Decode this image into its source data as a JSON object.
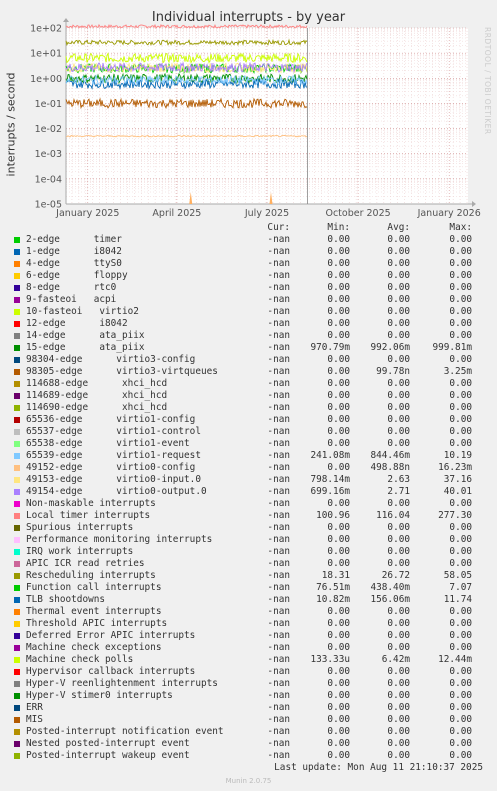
{
  "chart_data": {
    "type": "line",
    "title": "Individual interrupts - by year",
    "ylabel": "interrupts / second",
    "yscale": "log",
    "ylim": [
      1e-05,
      100
    ],
    "yticks": [
      "1e+02",
      "1e+01",
      "1e+00",
      "1e-01",
      "1e-02",
      "1e-03",
      "1e-04",
      "1e-05"
    ],
    "xlim": [
      "2024-12-10",
      "2026-01-20"
    ],
    "xticks": [
      {
        "label": "January 2025",
        "date": "2025-01-01"
      },
      {
        "label": "April 2025",
        "date": "2025-04-01"
      },
      {
        "label": "July 2025",
        "date": "2025-07-01"
      },
      {
        "label": "October 2025",
        "date": "2025-10-01"
      },
      {
        "label": "January 2026",
        "date": "2026-01-01"
      }
    ],
    "now_marker": "2025-08-11",
    "grid": true,
    "series": [
      {
        "name": "Local timer interrupts",
        "approx": 116.0
      },
      {
        "name": "Rescheduling interrupts",
        "approx": 26.7
      },
      {
        "name": "Machine check polls",
        "approx": 6.4
      },
      {
        "name": "Function call interrupts",
        "approx": 2.5
      },
      {
        "name": "49153-edge virtio0-input.0",
        "approx": 2.6
      },
      {
        "name": "49154-edge virtio0-output.0",
        "approx": 2.7
      },
      {
        "name": "15-edge ata_piix",
        "approx": 0.99
      },
      {
        "name": "TLB shootdowns",
        "approx": 0.6
      },
      {
        "name": "65539-edge virtio1-request",
        "approx": 0.84
      },
      {
        "name": "98305-edge virtio3-virtqueues",
        "approx": 0.1
      },
      {
        "name": "49152-edge virtio0-config",
        "approx": 0.005
      },
      {
        "name": "spike",
        "points": [
          [
            "2025-04-15",
            3e-05
          ],
          [
            "2025-07-05",
            3e-05
          ]
        ]
      }
    ]
  },
  "legend": {
    "headers": {
      "cur": "Cur:",
      "min": "Min:",
      "avg": "Avg:",
      "max": "Max:"
    },
    "rows": [
      {
        "label": "2-edge      timer",
        "color": "#00cc00",
        "cur": "-nan",
        "min": "0.00",
        "avg": "0.00",
        "max": "0.00"
      },
      {
        "label": "1-edge      i8042",
        "color": "#0066b3",
        "cur": "-nan",
        "min": "0.00",
        "avg": "0.00",
        "max": "0.00"
      },
      {
        "label": "4-edge      ttyS0",
        "color": "#ff8000",
        "cur": "-nan",
        "min": "0.00",
        "avg": "0.00",
        "max": "0.00"
      },
      {
        "label": "6-edge      floppy",
        "color": "#ffcc00",
        "cur": "-nan",
        "min": "0.00",
        "avg": "0.00",
        "max": "0.00"
      },
      {
        "label": "8-edge      rtc0",
        "color": "#330099",
        "cur": "-nan",
        "min": "0.00",
        "avg": "0.00",
        "max": "0.00"
      },
      {
        "label": "9-fasteoi   acpi",
        "color": "#990099",
        "cur": "-nan",
        "min": "0.00",
        "avg": "0.00",
        "max": "0.00"
      },
      {
        "label": "10-fasteoi   virtio2",
        "color": "#ccff00",
        "cur": "-nan",
        "min": "0.00",
        "avg": "0.00",
        "max": "0.00"
      },
      {
        "label": "12-edge      i8042",
        "color": "#ff0000",
        "cur": "-nan",
        "min": "0.00",
        "avg": "0.00",
        "max": "0.00"
      },
      {
        "label": "14-edge      ata_piix",
        "color": "#808080",
        "cur": "-nan",
        "min": "0.00",
        "avg": "0.00",
        "max": "0.00"
      },
      {
        "label": "15-edge      ata_piix",
        "color": "#008f00",
        "cur": "-nan",
        "min": "970.79m",
        "avg": "992.06m",
        "max": "999.81m"
      },
      {
        "label": "98304-edge      virtio3-config",
        "color": "#00487d",
        "cur": "-nan",
        "min": "0.00",
        "avg": "0.00",
        "max": "0.00"
      },
      {
        "label": "98305-edge      virtio3-virtqueues",
        "color": "#b35a00",
        "cur": "-nan",
        "min": "0.00",
        "avg": "99.78n",
        "max": "3.25m"
      },
      {
        "label": "114688-edge      xhci_hcd",
        "color": "#b38f00",
        "cur": "-nan",
        "min": "0.00",
        "avg": "0.00",
        "max": "0.00"
      },
      {
        "label": "114689-edge      xhci_hcd",
        "color": "#6b006b",
        "cur": "-nan",
        "min": "0.00",
        "avg": "0.00",
        "max": "0.00"
      },
      {
        "label": "114690-edge      xhci_hcd",
        "color": "#8fb300",
        "cur": "-nan",
        "min": "0.00",
        "avg": "0.00",
        "max": "0.00"
      },
      {
        "label": "65536-edge      virtio1-config",
        "color": "#b30000",
        "cur": "-nan",
        "min": "0.00",
        "avg": "0.00",
        "max": "0.00"
      },
      {
        "label": "65537-edge      virtio1-control",
        "color": "#bebebe",
        "cur": "-nan",
        "min": "0.00",
        "avg": "0.00",
        "max": "0.00"
      },
      {
        "label": "65538-edge      virtio1-event",
        "color": "#80ff80",
        "cur": "-nan",
        "min": "0.00",
        "avg": "0.00",
        "max": "0.00"
      },
      {
        "label": "65539-edge      virtio1-request",
        "color": "#80c9ff",
        "cur": "-nan",
        "min": "241.08m",
        "avg": "844.46m",
        "max": "10.19"
      },
      {
        "label": "49152-edge      virtio0-config",
        "color": "#ffc080",
        "cur": "-nan",
        "min": "0.00",
        "avg": "498.88n",
        "max": "16.23m"
      },
      {
        "label": "49153-edge      virtio0-input.0",
        "color": "#ffe680",
        "cur": "-nan",
        "min": "798.14m",
        "avg": "2.63",
        "max": "37.16"
      },
      {
        "label": "49154-edge      virtio0-output.0",
        "color": "#aa80ff",
        "cur": "-nan",
        "min": "699.16m",
        "avg": "2.71",
        "max": "40.01"
      },
      {
        "label": "Non-maskable interrupts",
        "color": "#ee00cc",
        "cur": "-nan",
        "min": "0.00",
        "avg": "0.00",
        "max": "0.00"
      },
      {
        "label": "Local timer interrupts",
        "color": "#ff8080",
        "cur": "-nan",
        "min": "100.96",
        "avg": "116.04",
        "max": "277.30"
      },
      {
        "label": "Spurious interrupts",
        "color": "#666600",
        "cur": "-nan",
        "min": "0.00",
        "avg": "0.00",
        "max": "0.00"
      },
      {
        "label": "Performance monitoring interrupts",
        "color": "#ffbfff",
        "cur": "-nan",
        "min": "0.00",
        "avg": "0.00",
        "max": "0.00"
      },
      {
        "label": "IRQ work interrupts",
        "color": "#00ffcc",
        "cur": "-nan",
        "min": "0.00",
        "avg": "0.00",
        "max": "0.00"
      },
      {
        "label": "APIC ICR read retries",
        "color": "#cc6699",
        "cur": "-nan",
        "min": "0.00",
        "avg": "0.00",
        "max": "0.00"
      },
      {
        "label": "Rescheduling interrupts",
        "color": "#999900",
        "cur": "-nan",
        "min": "18.31",
        "avg": "26.72",
        "max": "58.05"
      },
      {
        "label": "Function call interrupts",
        "color": "#00cc00",
        "cur": "-nan",
        "min": "76.51m",
        "avg": "438.40m",
        "max": "7.07"
      },
      {
        "label": "TLB shootdowns",
        "color": "#0066b3",
        "cur": "-nan",
        "min": "10.82m",
        "avg": "156.06m",
        "max": "11.74"
      },
      {
        "label": "Thermal event interrupts",
        "color": "#ff8000",
        "cur": "-nan",
        "min": "0.00",
        "avg": "0.00",
        "max": "0.00"
      },
      {
        "label": "Threshold APIC interrupts",
        "color": "#ffcc00",
        "cur": "-nan",
        "min": "0.00",
        "avg": "0.00",
        "max": "0.00"
      },
      {
        "label": "Deferred Error APIC interrupts",
        "color": "#330099",
        "cur": "-nan",
        "min": "0.00",
        "avg": "0.00",
        "max": "0.00"
      },
      {
        "label": "Machine check exceptions",
        "color": "#990099",
        "cur": "-nan",
        "min": "0.00",
        "avg": "0.00",
        "max": "0.00"
      },
      {
        "label": "Machine check polls",
        "color": "#ccff00",
        "cur": "-nan",
        "min": "133.33u",
        "avg": "6.42m",
        "max": "12.44m"
      },
      {
        "label": "Hypervisor callback interrupts",
        "color": "#ff0000",
        "cur": "-nan",
        "min": "0.00",
        "avg": "0.00",
        "max": "0.00"
      },
      {
        "label": "Hyper-V reenlightenment interrupts",
        "color": "#808080",
        "cur": "-nan",
        "min": "0.00",
        "avg": "0.00",
        "max": "0.00"
      },
      {
        "label": "Hyper-V stimer0 interrupts",
        "color": "#008f00",
        "cur": "-nan",
        "min": "0.00",
        "avg": "0.00",
        "max": "0.00"
      },
      {
        "label": "ERR",
        "color": "#00487d",
        "cur": "-nan",
        "min": "0.00",
        "avg": "0.00",
        "max": "0.00"
      },
      {
        "label": "MIS",
        "color": "#b35a00",
        "cur": "-nan",
        "min": "0.00",
        "avg": "0.00",
        "max": "0.00"
      },
      {
        "label": "Posted-interrupt notification event",
        "color": "#b38f00",
        "cur": "-nan",
        "min": "0.00",
        "avg": "0.00",
        "max": "0.00"
      },
      {
        "label": "Nested posted-interrupt event",
        "color": "#6b006b",
        "cur": "-nan",
        "min": "0.00",
        "avg": "0.00",
        "max": "0.00"
      },
      {
        "label": "Posted-interrupt wakeup event",
        "color": "#8fb300",
        "cur": "-nan",
        "min": "0.00",
        "avg": "0.00",
        "max": "0.00"
      }
    ]
  },
  "last_update": "Last update: Mon Aug 11 21:10:37 2025",
  "watermark": "RRDTOOL / TOBI OETIKER",
  "footer": "Munin 2.0.75"
}
